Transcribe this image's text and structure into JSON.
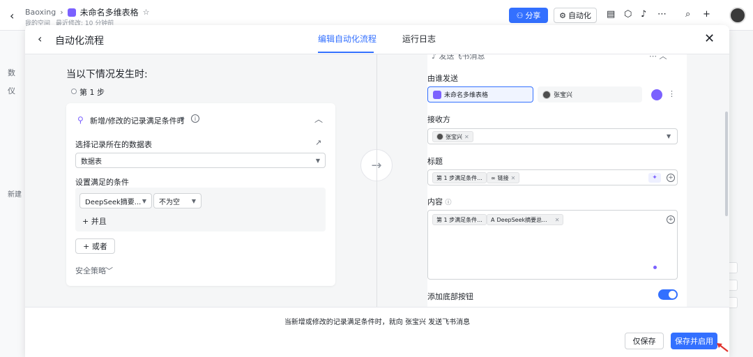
{
  "app": {
    "crumb_space": "Baoxing",
    "doc_title": "未命名多维表格",
    "sub_space": "我的空间",
    "sub_modified": "最近修改: 10 分钟前",
    "share_label": "分享",
    "auto_label": "自动化"
  },
  "sidebar": {
    "item_top_1": "数",
    "item_top_2": "仪",
    "new_label": "新建"
  },
  "modal": {
    "title": "自动化流程",
    "tabs": [
      "编辑自动化流程",
      "运行日志"
    ],
    "close": "✕"
  },
  "trigger": {
    "when_title": "当以下情况发生时:",
    "step_label": "第 1 步",
    "card_title": "新增/修改的记录满足条件时",
    "table_label": "选择记录所在的数据表",
    "table_value": "数据表",
    "cond_label": "设置满足的条件",
    "cond_field": "DeepSeek摘要...",
    "cond_op": "不为空",
    "and_label": "+ 并且",
    "or_label": "+ 或者",
    "safe_label": "安全策略"
  },
  "action": {
    "top_label": "发送飞书消息",
    "sender_label": "由谁发送",
    "sender_bot": "未命名多维表格",
    "sender_person": "张宝兴",
    "receiver_label": "接收方",
    "receiver_chip": "张宝兴",
    "title_label": "标题",
    "title_chip_1": "第 1 步满足条件...",
    "title_chip_2": "链接",
    "content_label": "内容",
    "content_chip_1": "第 1 步满足条件...",
    "content_chip_2": "DeepSeek摘要总...",
    "bottom_btn_label": "添加底部按钮"
  },
  "footer": {
    "summary": "当新增或修改的记录满足条件时，就向 张宝兴 发送飞书消息",
    "save": "仅保存",
    "save_enable": "保存并启用"
  },
  "colors": {
    "accent": "#3370ff",
    "purple": "#7b61ff",
    "arrow_red": "#e0332d"
  }
}
